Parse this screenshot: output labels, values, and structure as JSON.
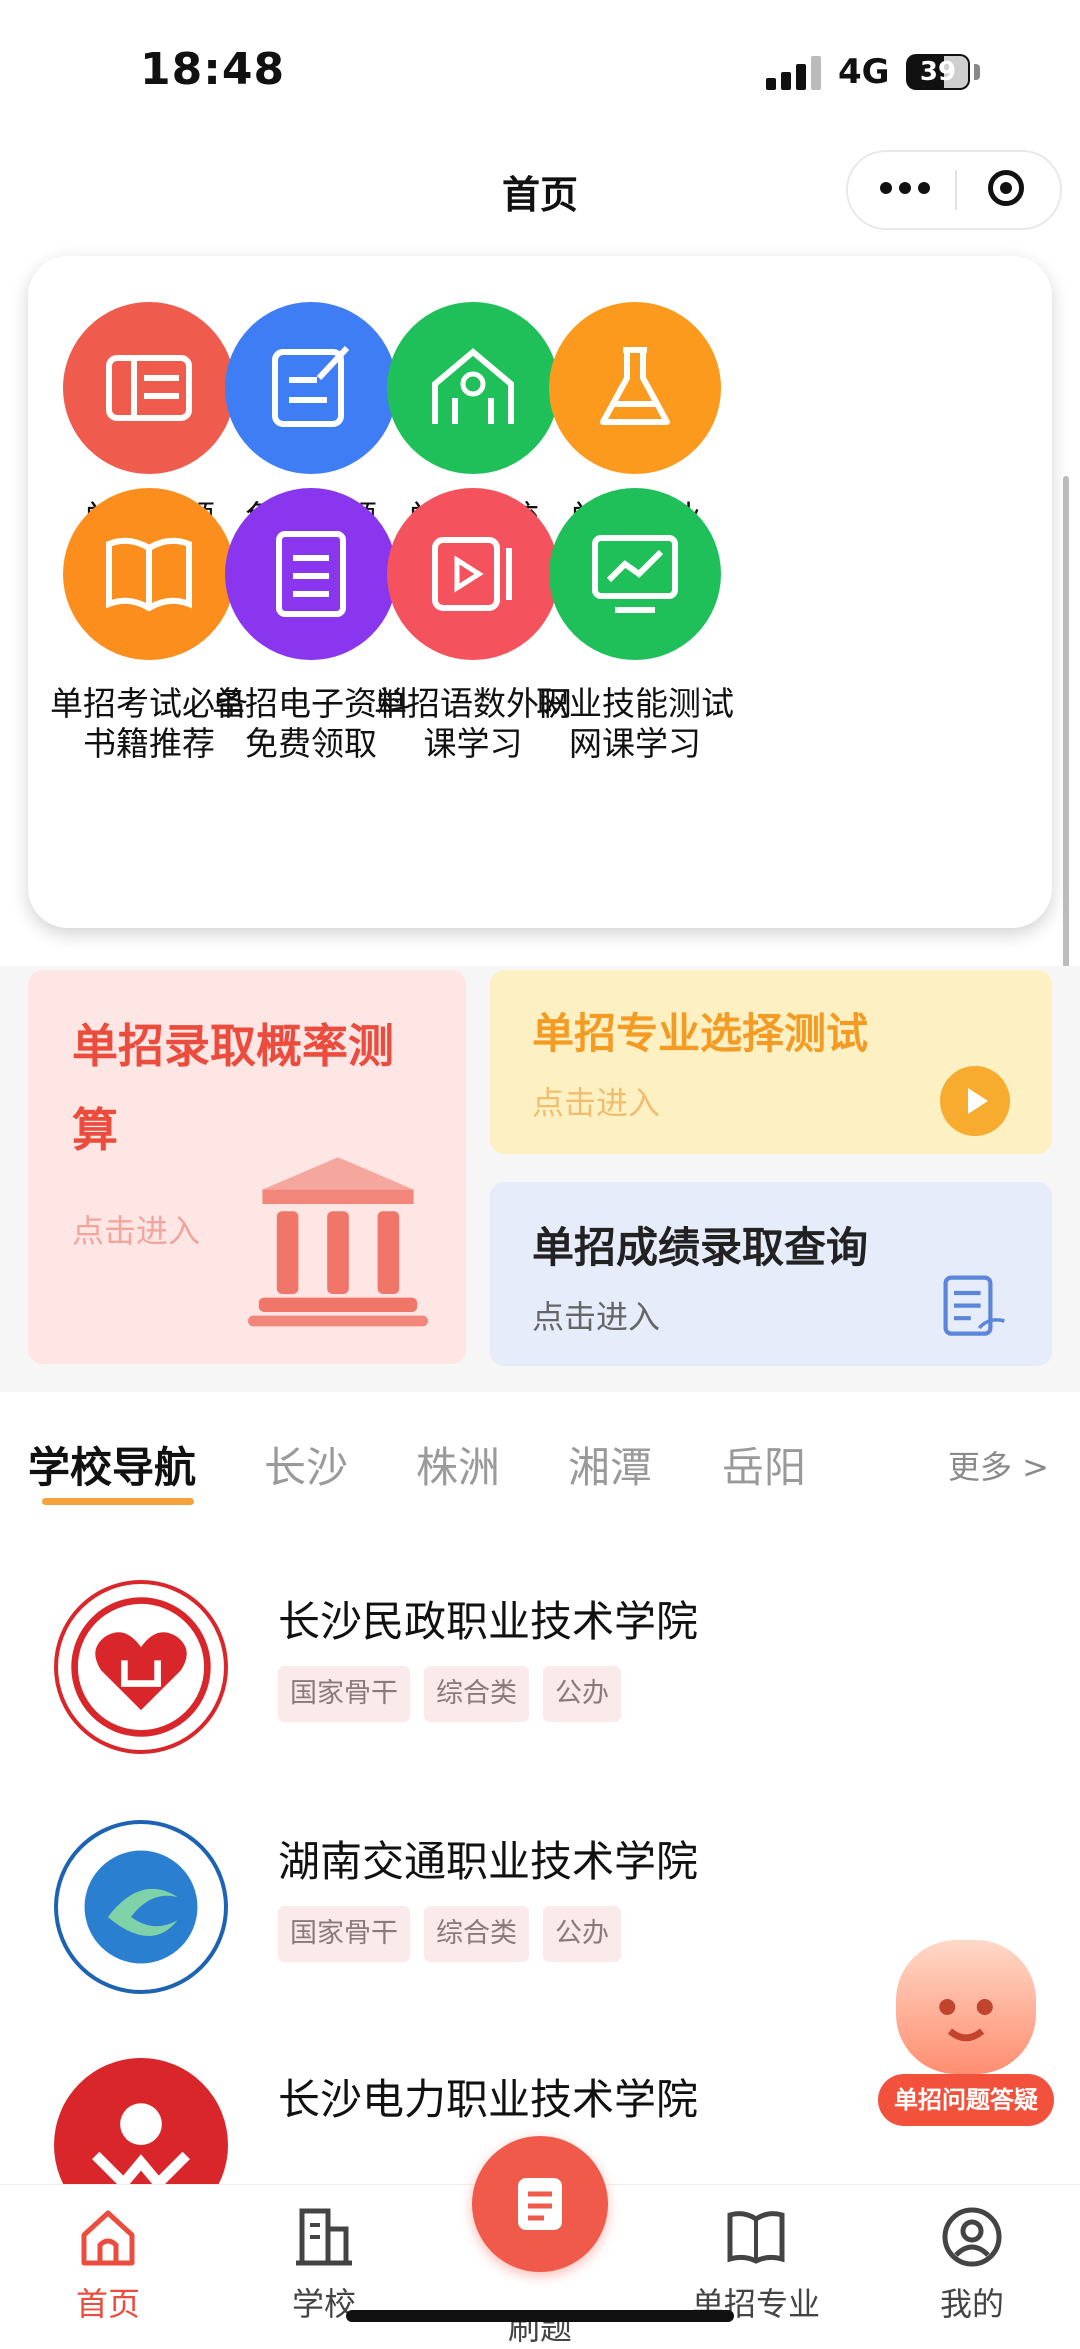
{
  "status_bar": {
    "time": "18:48",
    "network": "4G",
    "battery": "39"
  },
  "nav": {
    "title": "首页"
  },
  "grid": {
    "items": [
      {
        "label": "单招真题",
        "color": "#ef5b4d",
        "icon": "books-icon"
      },
      {
        "label": "免费刷题",
        "color": "#3f7df5",
        "icon": "edit-note-icon"
      },
      {
        "label": "单招院校",
        "color": "#1fbf5a",
        "icon": "school-building-icon"
      },
      {
        "label": "单招专业",
        "color": "#fb9a1d",
        "icon": "flask-icon"
      },
      {
        "label_line1": "单招考试必备",
        "label_line2": "书籍推荐",
        "color": "#fb8e1d",
        "icon": "open-book-icon"
      },
      {
        "label_line1": "单招电子资料",
        "label_line2": "免费领取",
        "color": "#8a35ee",
        "icon": "document-icon"
      },
      {
        "label_line1": "单招语数外网",
        "label_line2": "课学习",
        "color": "#f4525c",
        "icon": "video-play-icon"
      },
      {
        "label_line1": "职业技能测试",
        "label_line2": "网课学习",
        "color": "#1fbf5a",
        "icon": "monitor-chart-icon"
      }
    ]
  },
  "promo": {
    "left": {
      "title": "单招录取概率测算",
      "sub": "点击进入"
    },
    "top_right": {
      "title": "单招专业选择测试",
      "sub": "点击进入"
    },
    "bottom_right": {
      "title": "单招成绩录取查询",
      "sub": "点击进入"
    }
  },
  "school_nav": {
    "tabs": [
      "学校导航",
      "长沙",
      "株洲",
      "湘潭",
      "岳阳"
    ],
    "more": "更多 >"
  },
  "schools": [
    {
      "name": "长沙民政职业技术学院",
      "tags": [
        "国家骨干",
        "综合类",
        "公办"
      ]
    },
    {
      "name": "湖南交通职业技术学院",
      "tags": [
        "国家骨干",
        "综合类",
        "公办"
      ]
    },
    {
      "name": "长沙电力职业技术学院",
      "tags": []
    }
  ],
  "assistant": {
    "label": "单招问题答疑"
  },
  "tabbar": {
    "items": [
      "首页",
      "学校",
      "刷题",
      "单招专业",
      "我的"
    ]
  }
}
